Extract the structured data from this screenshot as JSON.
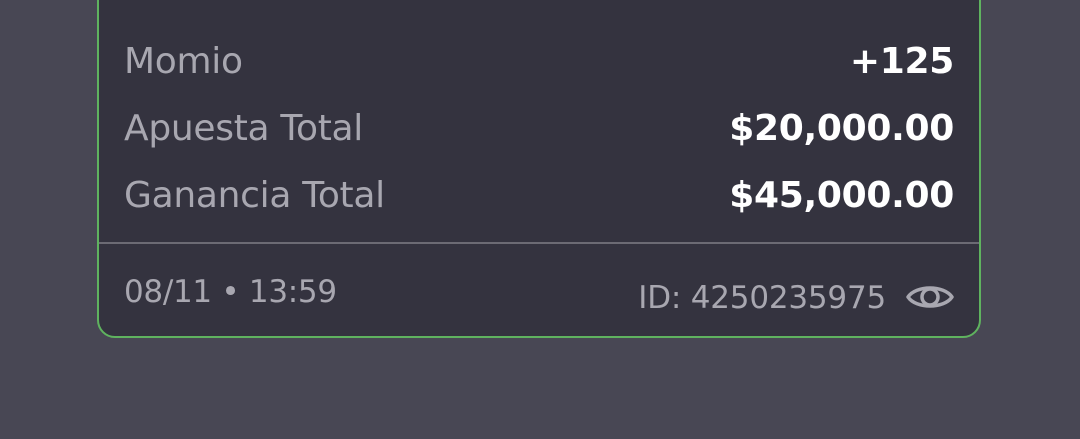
{
  "card": {
    "odds": {
      "label": "Momio",
      "value": "+125"
    },
    "stake": {
      "label": "Apuesta Total",
      "value": "$20,000.00"
    },
    "winnings": {
      "label": "Ganancia Total",
      "value": "$45,000.00"
    },
    "footer": {
      "timestamp": "08/11 • 13:59",
      "ticket_id": "ID:  4250235975",
      "eye_icon": "eye-icon"
    }
  },
  "colors": {
    "background": "#484754",
    "card": "#34333f",
    "border": "#5fb35f",
    "label": "#a8a7b0",
    "value": "#ffffff"
  }
}
